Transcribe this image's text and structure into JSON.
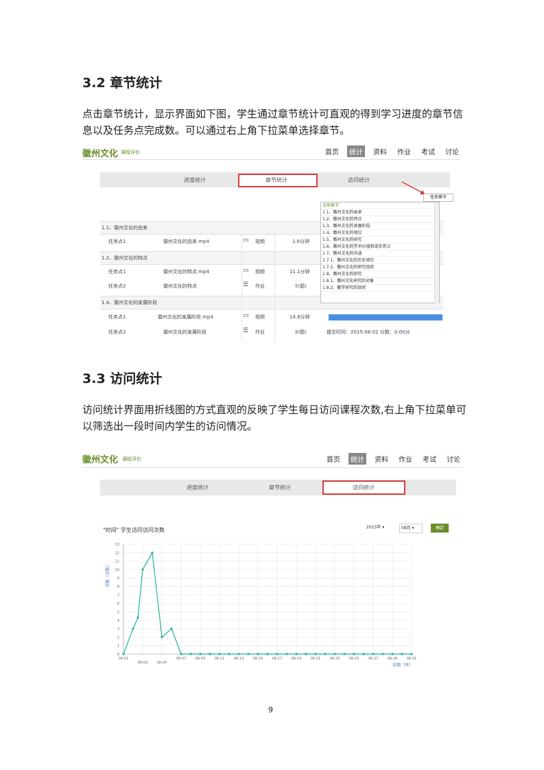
{
  "section_32": {
    "heading": "3.2 章节统计",
    "para": "点击章节统计，显示界面如下图，学生通过章节统计可直观的得到学习进度的章节信息以及任务点完成数。可以通过右上角下拉菜单选择章节。"
  },
  "section_33": {
    "heading": "3.3 访问统计",
    "para": "访问统计界面用折线图的方式直观的反映了学生每日访问课程次数,右上角下拉菜单可以筛选出一段时间内学生的访问情况。"
  },
  "app": {
    "logo": "徽州文化",
    "logo_sub": "课程评价",
    "nav": [
      "首页",
      "统计",
      "资料",
      "作业",
      "考试",
      "讨论"
    ],
    "active_nav": "统计"
  },
  "shot1": {
    "tabs": [
      "进度统计",
      "章节统计",
      "访问统计"
    ],
    "chapter_button": "任务章节",
    "rows": [
      {
        "type": "head",
        "label": "1.1、徽州文化的由来"
      },
      {
        "type": "item",
        "col1": "任务点1",
        "col2": "徽州文化的由来.mp4",
        "col3": "视频",
        "col4": "1.6分钟",
        "col5": ""
      },
      {
        "type": "head",
        "label": "1.2、徽州文化的特点"
      },
      {
        "type": "item",
        "col1": "任务点1",
        "col2": "徽州文化的特点.mp4",
        "col3": "视频",
        "col4": "11.1分钟",
        "col5": ""
      },
      {
        "type": "item",
        "col1": "任务点2",
        "col2": "徽州文化的特点",
        "col3": "作业",
        "col4": "5(题)",
        "col5": ""
      },
      {
        "type": "head",
        "label": "1.4、徽州文化的发展阶段"
      },
      {
        "type": "item",
        "col1": "任务点1",
        "col2": "徽州文化的发展阶段.mp4",
        "col3": "视频",
        "col4": "14.8分钟",
        "col5": ""
      },
      {
        "type": "item",
        "col1": "任务点2",
        "col2": "徽州文化的发展阶段",
        "col3": "作业",
        "col4": "5(题)",
        "col5": "提交时间：2015-08-02  分数：0.00分"
      }
    ],
    "dropdown": [
      "全部章节",
      "1.1、徽州文化的由来",
      "1.2、徽州文化的特点",
      "1.3、徽州文化的发展阶段",
      "1.4、徽州文化的地位",
      "1.5、徽州文化的研究",
      "1.6、徽州文化的学术价值和现实意义",
      "1.7、徽州文化的内涵",
      "1.7.1、徽州文化的历史地位",
      "1.7.2、徽州文化的研究现状",
      "1.8、徽州文化的研究",
      "1.8.1、徽州文化研究的对象",
      "1.8.2、徽学研究的现状"
    ]
  },
  "shot2": {
    "tabs": [
      "进度统计",
      "章节统计",
      "访问统计"
    ],
    "chart_title": "\"时间\" 学生访问访问次数",
    "year_select": "2015年",
    "month_select": "08月",
    "confirm": "确定",
    "ylabel": "次数（次数）",
    "xlabel": "日期（天）"
  },
  "chart_data": {
    "type": "line",
    "title": "\"时间\" 学生访问访问次数",
    "ylabel": "次数（次数）",
    "xlabel": "日期（天）",
    "ylim": [
      0,
      13
    ],
    "yticks": [
      0,
      1,
      2,
      3,
      4,
      5,
      6,
      7,
      8,
      9,
      10,
      11,
      12,
      13
    ],
    "xticks_row1": [
      "08-01",
      "08-07",
      "08-09",
      "08-11",
      "08-13",
      "08-15",
      "08-17",
      "08-19",
      "08-21",
      "08-23",
      "08-25",
      "08-27",
      "08-29",
      "08-31"
    ],
    "xticks_row2": [
      "08-03",
      "08-05"
    ],
    "x": [
      1,
      2,
      2.5,
      3,
      4,
      5,
      6,
      7,
      8,
      9,
      10,
      11,
      12,
      13,
      14,
      15,
      16,
      17,
      18,
      19,
      20,
      21,
      22,
      23,
      24,
      25,
      26,
      27,
      28,
      29,
      30,
      31
    ],
    "series": [
      {
        "values": [
          0,
          3,
          4.3,
          10,
          12,
          2,
          3,
          0,
          0,
          0,
          0,
          0,
          0,
          0,
          0,
          0,
          0,
          0,
          0,
          0,
          0,
          0,
          0,
          0,
          0,
          0,
          0,
          0,
          0,
          0,
          0,
          0
        ]
      }
    ],
    "grid": true,
    "color": "#1fb39a"
  },
  "page_number": "9"
}
